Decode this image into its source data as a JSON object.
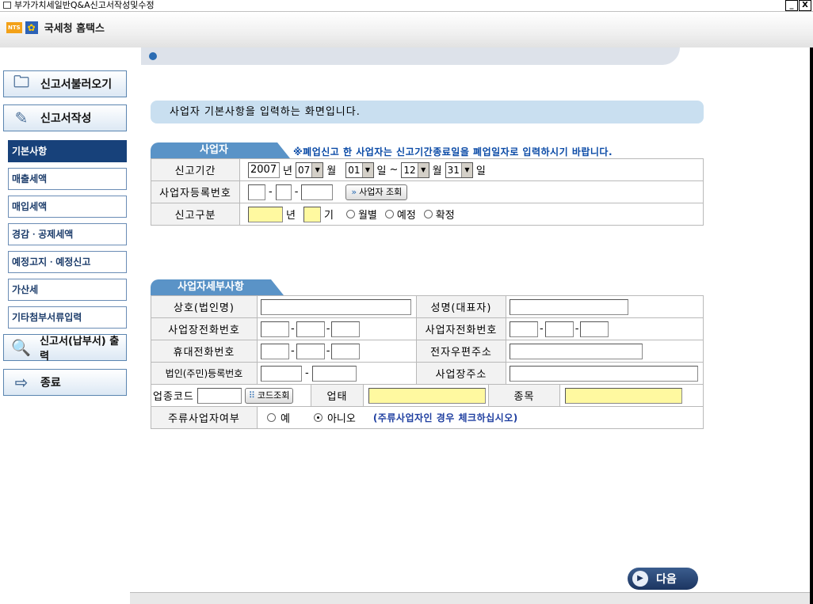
{
  "window": {
    "title": "부가가치세일반Q&A신고서작성및수정",
    "minimize": "_",
    "close": "X"
  },
  "brand": {
    "nts": "NTS",
    "name": "국세청 홈택스"
  },
  "sidebar": {
    "load": "신고서불러오기",
    "write": "신고서작성",
    "items": [
      "기본사항",
      "매출세액",
      "매입세액",
      "경감ㆍ공제세액",
      "예정고지ㆍ예정신고",
      "가산세",
      "기타첨부서류입력"
    ],
    "print": "신고서(납부서) 출력",
    "exit": "종료"
  },
  "banner": "사업자 기본사항을 입력하는 화면입니다.",
  "business": {
    "tab": "사업자",
    "notice": "※폐업신고 한 사업자는 신고기간종료일을 폐업일자로 입력하시기 바랍니다.",
    "period_label": "신고기간",
    "year": "2007",
    "year_unit": "년",
    "start_month": "07",
    "month_unit": "월",
    "start_day": "01",
    "day_unit": "일",
    "tilde": "~",
    "end_month": "12",
    "end_day": "31",
    "regno_label": "사업자등록번호",
    "dash": "-",
    "lookup_button": "사업자 조회",
    "type_label": "신고구분",
    "period_unit": "기",
    "options": [
      "월별",
      "예정",
      "확정"
    ]
  },
  "detail": {
    "tab": "사업자세부사항",
    "company_label": "상호(법인명)",
    "rep_label": "성명(대표자)",
    "office_phone_label": "사업장전화번호",
    "biz_phone_label": "사업자전화번호",
    "mobile_label": "휴대전화번호",
    "email_label": "전자우편주소",
    "corp_reg_label": "법인(주민)등록번호",
    "address_label": "사업장주소",
    "industry_label": "업종코드",
    "code_button": "코드조회",
    "business_type_label": "업태",
    "item_label": "종목",
    "liquor_label": "주류사업자여부",
    "yes": "예",
    "no": "아니오",
    "liquor_note": "(주류사업자인 경우 체크하십시오)"
  },
  "next_button": "다음"
}
